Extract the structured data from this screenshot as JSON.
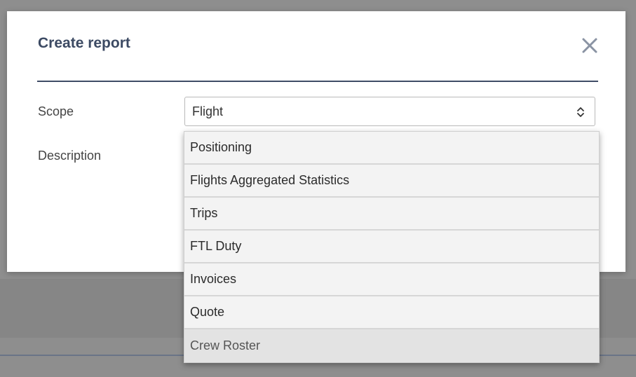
{
  "dialog": {
    "title": "Create report",
    "close_icon": "close-icon"
  },
  "form": {
    "scope_label": "Scope",
    "scope_value": "Flight",
    "description_label": "Description"
  },
  "dropdown": {
    "options": [
      {
        "label": "Positioning"
      },
      {
        "label": "Flights Aggregated Statistics"
      },
      {
        "label": "Trips"
      },
      {
        "label": "FTL Duty"
      },
      {
        "label": "Invoices"
      },
      {
        "label": "Quote"
      },
      {
        "label": "Crew Roster",
        "highlighted": true
      }
    ]
  },
  "colors": {
    "title": "#3c4a63",
    "divider": "#3f4c66",
    "overlay": "#8e8e8e",
    "dropdown_bg": "#f3f3f3",
    "highlight_bg": "#e3e3e3"
  }
}
